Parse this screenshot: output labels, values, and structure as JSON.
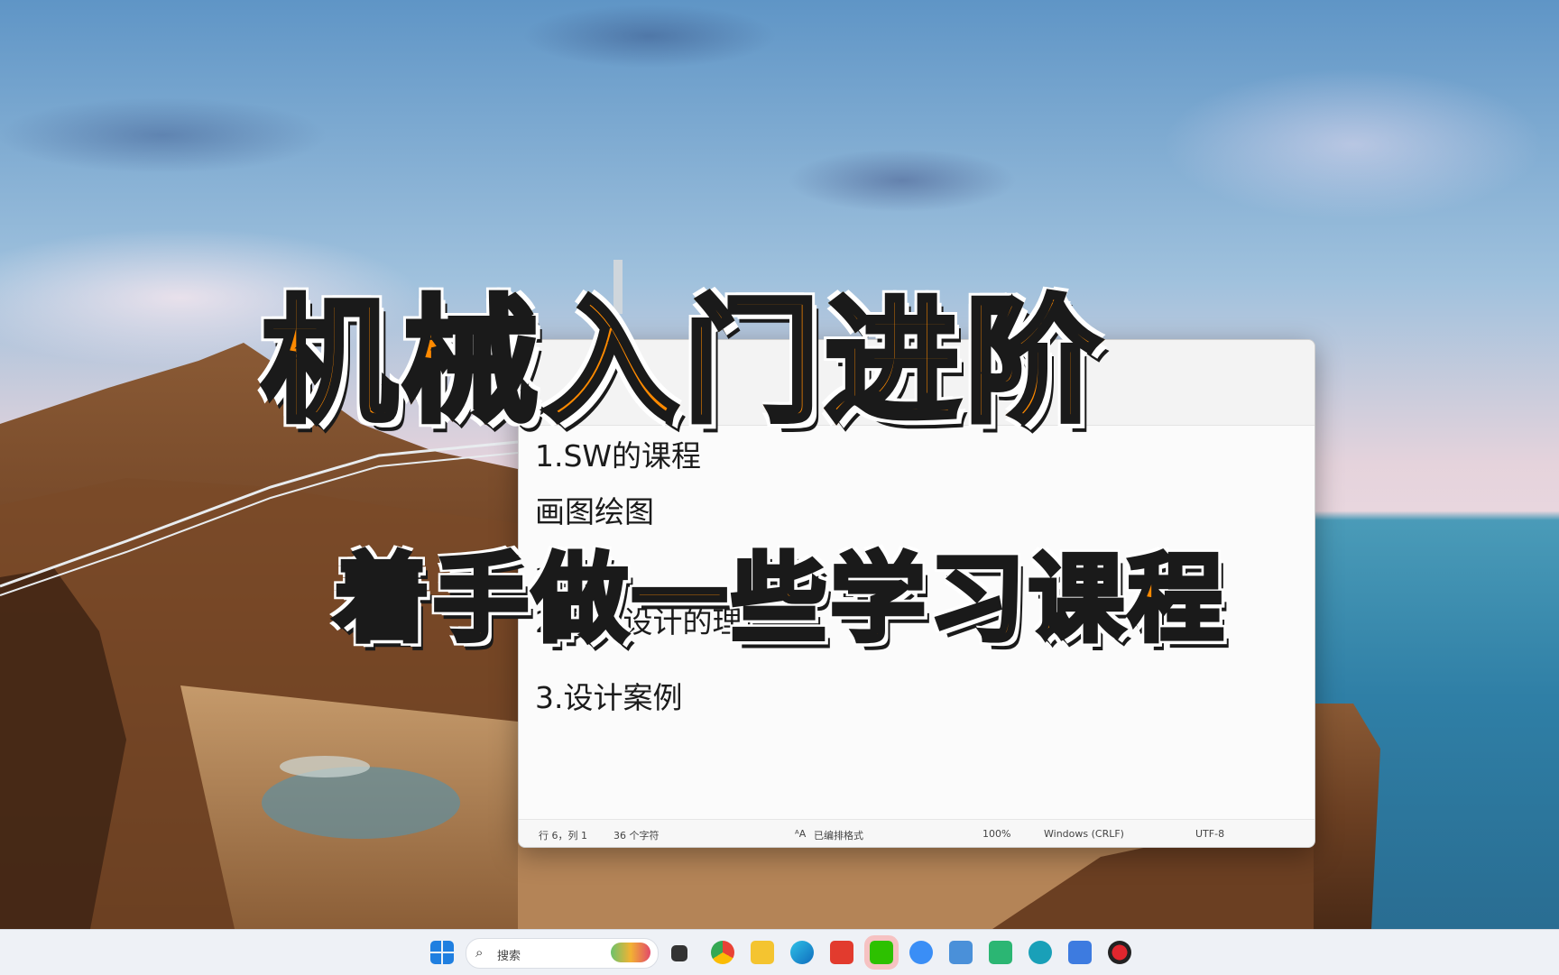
{
  "overlay": {
    "title_main": "机械入门进阶",
    "title_sub": "着手做一些学习课程"
  },
  "notepad": {
    "lines": [
      "1.SW的课程",
      "画图绘图",
      "1.",
      "2.机械设计的理论",
      "3.设计案例"
    ],
    "status": {
      "position": "行 6，列 1",
      "chars": "36 个字符",
      "format": "已编排格式",
      "zoom": "100%",
      "line_ending": "Windows (CRLF)",
      "encoding": "UTF-8"
    }
  },
  "taskbar": {
    "search_placeholder": "搜索",
    "apps": [
      "start-icon",
      "search",
      "widgets-icon",
      "task-view-icon",
      "chrome-icon",
      "file-explorer-icon",
      "edge-icon",
      "wps-icon",
      "wechat-icon",
      "baidu-netdisk-icon",
      "remote-desktop-icon",
      "screen-share-icon",
      "cloud-sync-icon",
      "notepad-icon",
      "recorder-icon"
    ]
  },
  "colors": {
    "title_fill": "#ff9a10",
    "title_outline": "#1a1a1a",
    "taskbar_bg": "#eef1f6",
    "notepad_bg": "#fbfbfb"
  }
}
